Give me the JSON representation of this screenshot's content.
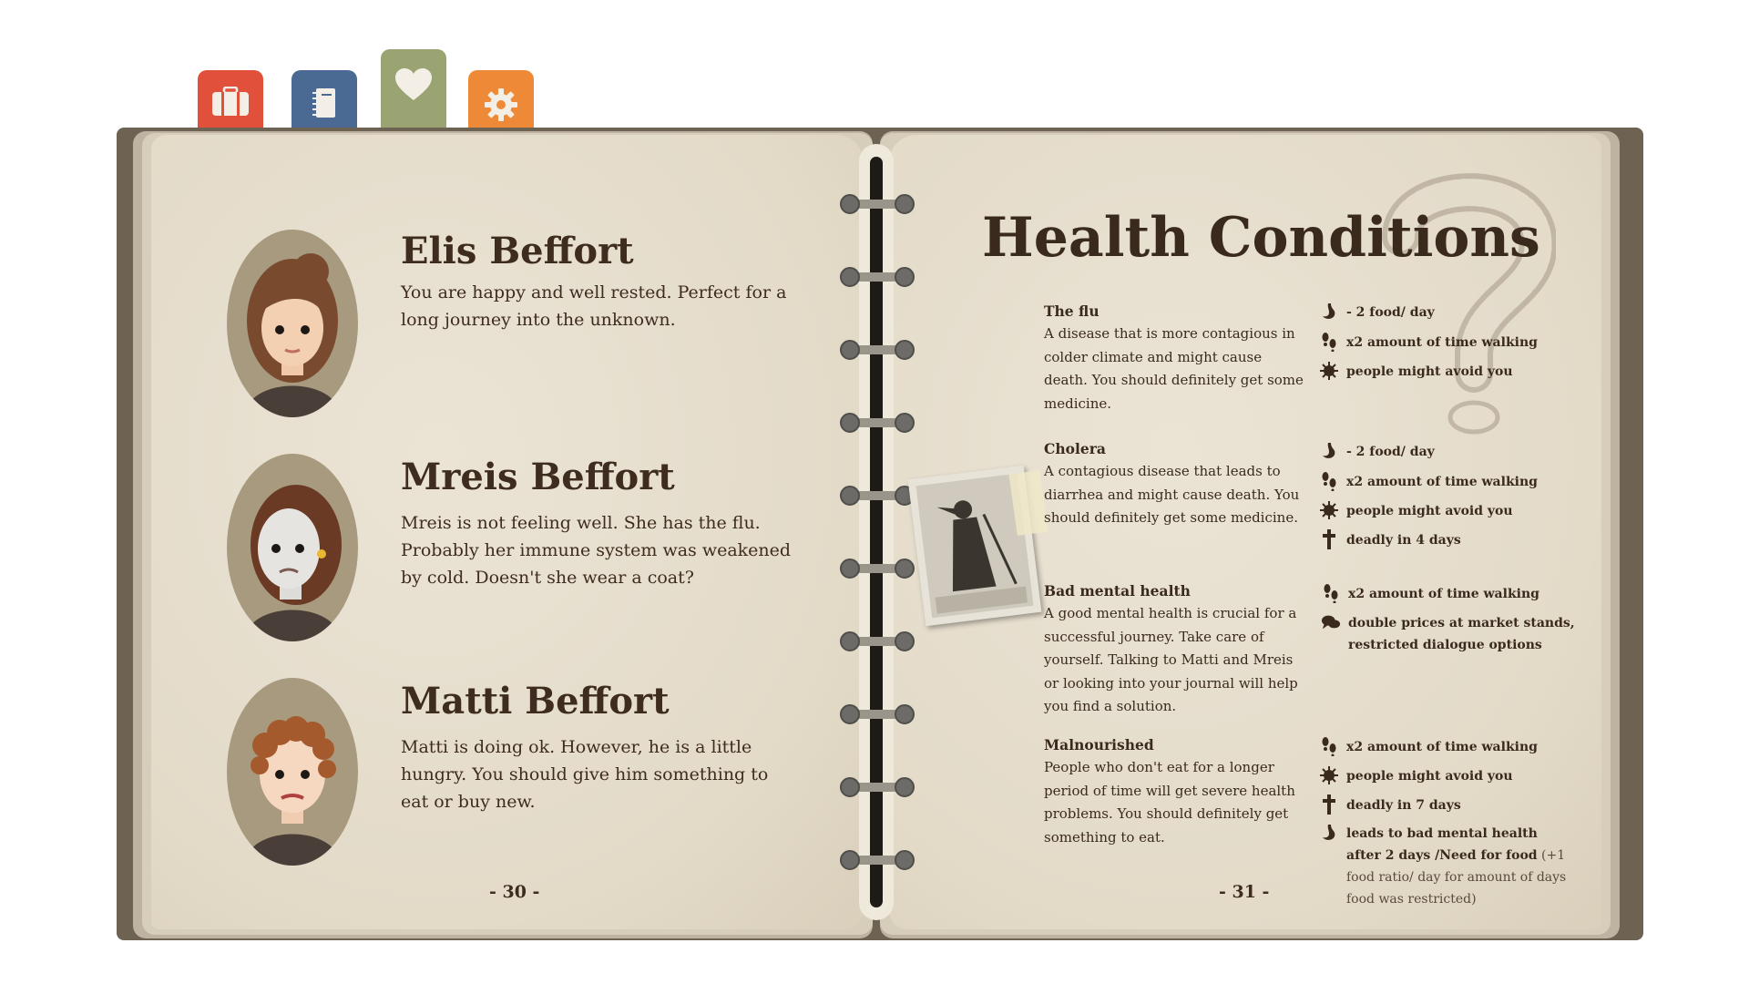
{
  "tabs": [
    {
      "name": "inventory",
      "icon": "suitcase-icon",
      "color": "#e0503b"
    },
    {
      "name": "journal",
      "icon": "notebook-icon",
      "color": "#4a6a93"
    },
    {
      "name": "health",
      "icon": "heart-icon",
      "color": "#9aa372",
      "active": true
    },
    {
      "name": "settings",
      "icon": "gear-icon",
      "color": "#ee8a37"
    }
  ],
  "left_page": {
    "characters": [
      {
        "name": "Elis Beffort",
        "description": "You are happy and well rested. Perfect for a long journey into the unknown."
      },
      {
        "name": "Mreis Beffort",
        "description": "Mreis is not feeling well. She has the flu. Probably her immune system was weakened by cold. Doesn't she wear a coat?"
      },
      {
        "name": "Matti Beffort",
        "description": "Matti is doing ok. However, he is a little hungry. You should give him something to eat or buy new."
      }
    ],
    "page_number": "- 30 -"
  },
  "right_page": {
    "title": "Health Conditions",
    "conditions": [
      {
        "title": "The flu",
        "description": "A disease that is more contagious in colder climate and might cause death. You should definitely get some medicine.",
        "effects": [
          {
            "icon": "stomach-icon",
            "text": "- 2 food/ day"
          },
          {
            "icon": "footsteps-icon",
            "text": "x2 amount of time walking"
          },
          {
            "icon": "virus-icon",
            "text": "people might avoid you"
          }
        ]
      },
      {
        "title": "Cholera",
        "description": "A contagious disease that leads to diarrhea and might cause death. You should definitely get some medicine.",
        "effects": [
          {
            "icon": "stomach-icon",
            "text": "- 2 food/ day"
          },
          {
            "icon": "footsteps-icon",
            "text": "x2 amount of time walking"
          },
          {
            "icon": "virus-icon",
            "text": "people might avoid you"
          },
          {
            "icon": "cross-icon",
            "text": "deadly in 4 days"
          }
        ]
      },
      {
        "title": "Bad mental health",
        "description": "A good mental health is crucial for a successful journey. Take care of yourself. Talking to Matti and Mreis or looking into your journal will help you find a solution.",
        "effects": [
          {
            "icon": "footsteps-icon",
            "text": "x2 amount of time walking"
          },
          {
            "icon": "speech-bubbles-icon",
            "text": "double prices at market stands,",
            "text2": "restricted dialogue options"
          }
        ]
      },
      {
        "title": "Malnourished",
        "description": "People who don't eat for a longer period of time will get severe health problems. You should definitely get something to eat.",
        "effects": [
          {
            "icon": "footsteps-icon",
            "text": "x2 amount of time walking"
          },
          {
            "icon": "virus-icon",
            "text": "people might avoid you"
          },
          {
            "icon": "cross-icon",
            "text": "deadly in 7 days"
          },
          {
            "icon": "stomach-icon",
            "text": "leads to bad mental health after 2 days /Need for food",
            "note": "(+1 food ratio/ day for amount of days food was restricted)"
          }
        ]
      }
    ],
    "page_number": "- 31 -"
  }
}
